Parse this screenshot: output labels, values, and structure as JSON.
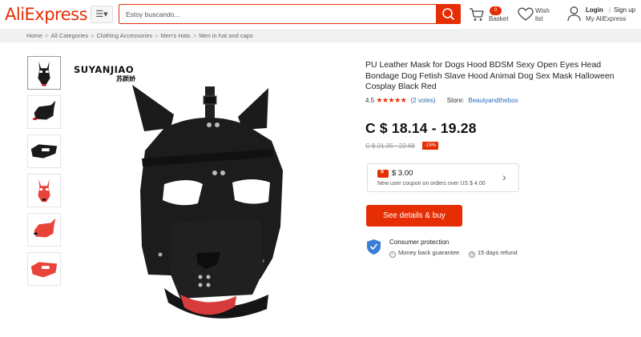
{
  "header": {
    "logo": "AliExpress",
    "search_placeholder": "Estoy buscando...",
    "basket_count": "0",
    "basket_label": "Basket",
    "wish_label": "Wish list",
    "login_label": "Login",
    "separator": "|",
    "signup_label": "Sign up",
    "my_account_label": "My AliExpress"
  },
  "breadcrumb": [
    "Home",
    "All Categories",
    "Clothing Accessories",
    "Men's Hats",
    "Men in hat and caps"
  ],
  "breadcrumb_separator": ">",
  "gallery": {
    "watermark": "SUYANJIAO",
    "watermark_cn": "苏颜娇",
    "thumbnails": [
      "black-front",
      "black-side",
      "black-flat",
      "red-front",
      "red-side",
      "red-flat"
    ]
  },
  "product": {
    "title": "PU Leather Mask for Dogs Hood BDSM Sexy Open Eyes Head Bondage Dog Fetish Slave Hood Animal Dog Sex Mask Halloween Cosplay Black Red",
    "rating": "4.5",
    "stars": "★★★★★",
    "votes": "(2 votes)",
    "store_label": "Store:",
    "store_name": "Beautyandthebox",
    "price": "C $ 18.14 - 19.28",
    "old_price": "C $ 21.35 - 22.68",
    "discount": "-15%",
    "coupon_amount": "$ 3.00",
    "coupon_desc": "New user coupon on orders over US $ 4.00",
    "buy_button": "See details & buy",
    "protection_title": "Consumer protection",
    "protection_items": [
      "Money back guarantee",
      "15 days refund"
    ]
  },
  "colors": {
    "accent": "#e62e04",
    "link": "#2b6ab5"
  }
}
